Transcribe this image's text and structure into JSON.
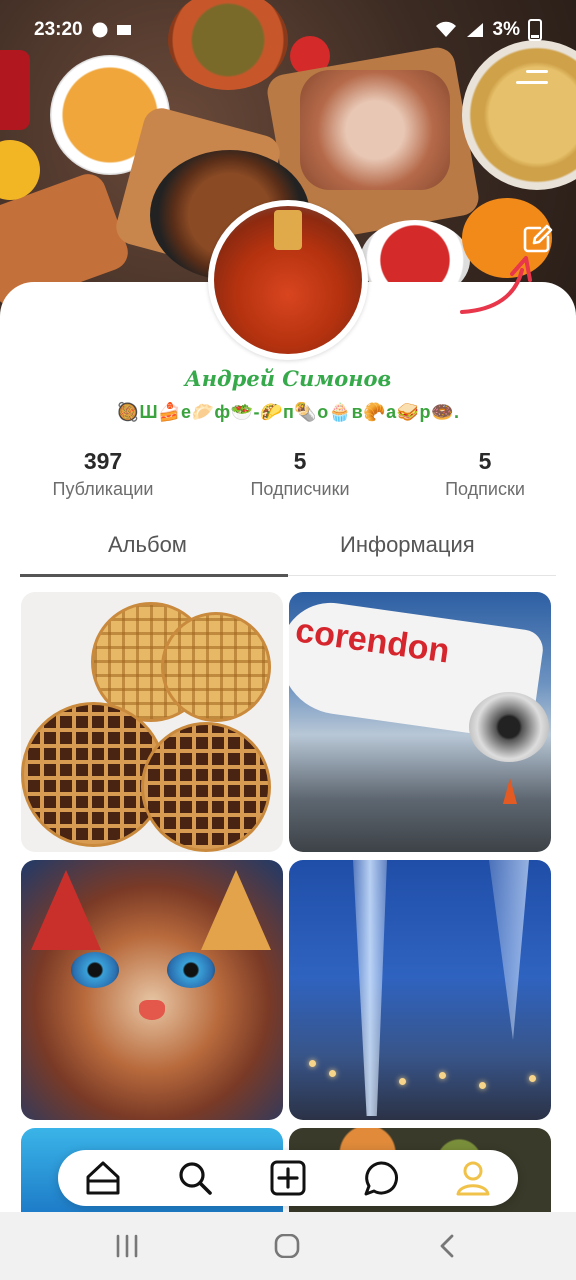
{
  "status_bar": {
    "time": "23:20",
    "battery": "3%"
  },
  "profile": {
    "name": "Андрей Симонов",
    "bio": "🥘Ш🍰е🥟ф🥗-🌮п🌯о🧁в🥐а🥪р🍩."
  },
  "stats": [
    {
      "value": "397",
      "label": "Публикации"
    },
    {
      "value": "5",
      "label": "Подписчики"
    },
    {
      "value": "5",
      "label": "Подписки"
    }
  ],
  "tabs": [
    {
      "label": "Альбом",
      "active": true
    },
    {
      "label": "Информация",
      "active": false
    }
  ],
  "grid": {
    "plane_text": "corendon"
  },
  "bottom_nav": {
    "items": [
      "home-icon",
      "search-icon",
      "add-post-icon",
      "chat-icon",
      "profile-icon"
    ],
    "active_color": "#f0c24a"
  },
  "colors": {
    "name": "#36a94a",
    "arrow": "#e8364a"
  }
}
